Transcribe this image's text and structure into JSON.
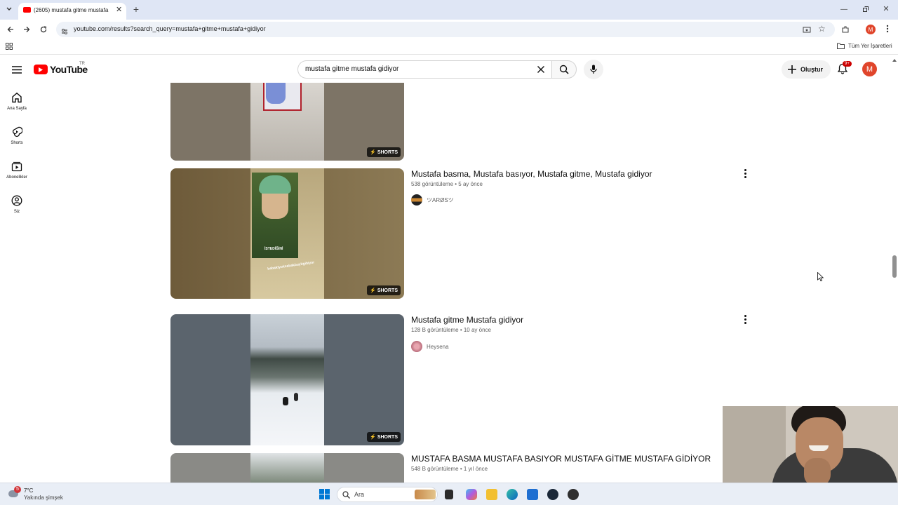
{
  "browser": {
    "tab_title": "(2605) mustafa gitme mustafa g",
    "url": "youtube.com/results?search_query=mustafa+gitme+mustafa+gidiyor",
    "bookmarks_label": "Tüm Yer İşaretleri",
    "profile_letter": "M"
  },
  "header": {
    "logo_text": "YouTube",
    "region": "TR",
    "search_value": "mustafa gitme mustafa gidiyor",
    "create_label": "Oluştur",
    "notif_badge": "9+",
    "avatar_letter": "M"
  },
  "sidebar": {
    "items": [
      {
        "label": "Ana Sayfa",
        "icon": "home-icon"
      },
      {
        "label": "Shorts",
        "icon": "shorts-icon"
      },
      {
        "label": "Abonelikler",
        "icon": "subscriptions-icon"
      },
      {
        "label": "Siz",
        "icon": "account-icon"
      }
    ]
  },
  "results": [
    {
      "badge": "SHORTS"
    },
    {
      "title": "Mustafa basma, Mustafa basıyor, Mustafa gitme, Mustafa gidiyor",
      "views": "538 görüntüleme",
      "age": "5 ay önce",
      "channel": "ツARØSツ",
      "badge": "SHORTS",
      "thumb_caption": "İSTEDİĞİNİ",
      "thumb_subcaption": "babaktyoksabakbuyitgibiyor"
    },
    {
      "title": "Mustafa gitme Mustafa gidiyor",
      "views": "128 B görüntüleme",
      "age": "10 ay önce",
      "channel": "Heysena",
      "badge": "SHORTS"
    },
    {
      "title": "MUSTAFA BASMA MUSTAFA BASIYOR MUSTAFA GİTME MUSTAFA GİDİYOR",
      "views": "548 B görüntüleme",
      "age": "1 yıl önce"
    }
  ],
  "taskbar": {
    "weather_temp": "7°C",
    "weather_desc": "Yakında şimşek",
    "weather_badge": "5",
    "search_placeholder": "Ara"
  },
  "colors": {
    "youtube_red": "#ff0000",
    "avatar_bg": "#e0452b",
    "tab_strip": "#dfe6f5"
  }
}
